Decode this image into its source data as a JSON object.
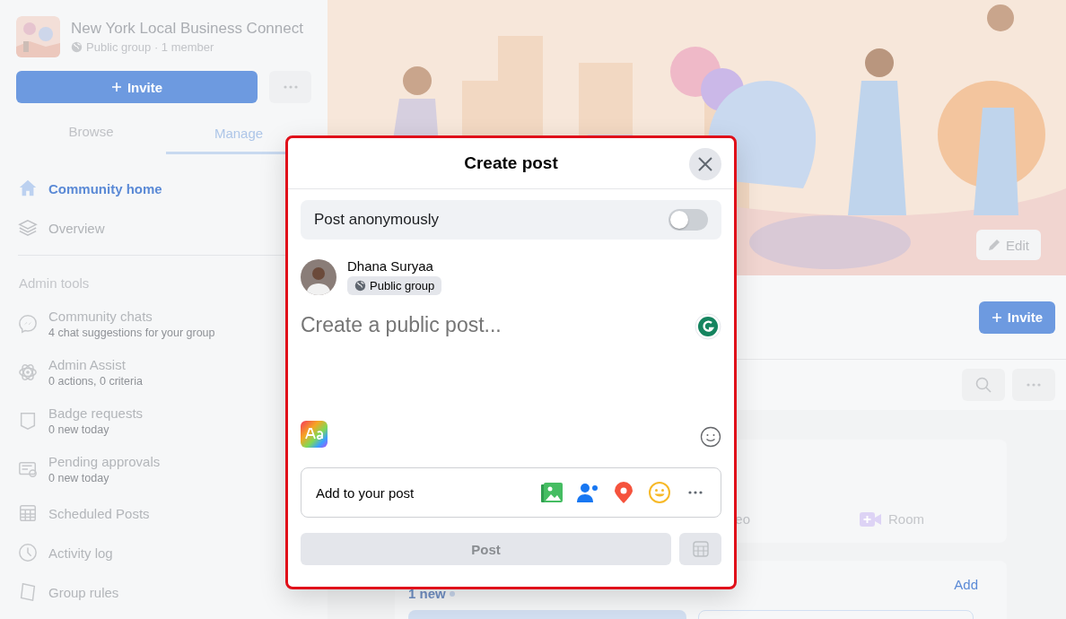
{
  "sidebar": {
    "group": {
      "name": "New York Local Business Connect",
      "meta": "Public group · 1 member"
    },
    "invite_button": "Invite",
    "tabs": [
      {
        "label": "Browse",
        "selected": false
      },
      {
        "label": "Manage",
        "selected": true
      }
    ],
    "nav": [
      {
        "label": "Community home",
        "selected": true
      },
      {
        "label": "Overview",
        "selected": false
      }
    ],
    "admin_tools": {
      "heading": "Admin tools",
      "items": [
        {
          "label": "Community chats",
          "detail": "4 chat suggestions for your group"
        },
        {
          "label": "Admin Assist",
          "detail": "0 actions, 0 criteria"
        },
        {
          "label": "Badge requests",
          "detail": "0 new today"
        },
        {
          "label": "Pending approvals",
          "detail": "0 new today"
        },
        {
          "label": "Scheduled Posts"
        },
        {
          "label": "Activity log"
        },
        {
          "label": "Group rules"
        }
      ]
    }
  },
  "cover": {
    "edit_button": "Edit"
  },
  "header": {
    "invite_button": "Invite"
  },
  "feed": {
    "composer_options": [
      "eo",
      "Room"
    ],
    "section": {
      "link": "Add",
      "badge": "1 new"
    }
  },
  "dialog": {
    "title": "Create post",
    "anonymous": {
      "label": "Post anonymously",
      "on": false
    },
    "author": {
      "name": "Dhana Suryaa",
      "audience": "Public group"
    },
    "composer": {
      "placeholder": "Create a public post..."
    },
    "add_to_post": {
      "label": "Add to your post"
    },
    "post_button": {
      "label": "Post",
      "disabled": true
    }
  }
}
